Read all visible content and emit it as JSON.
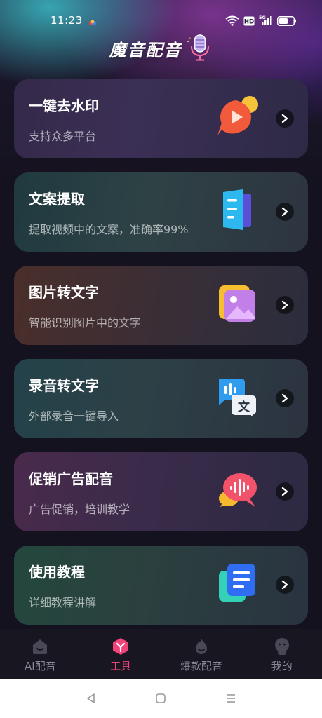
{
  "status_bar": {
    "time": "11:23",
    "hd_badge": "HD",
    "network": "5G",
    "icons": [
      "app-notification-icon",
      "wifi-icon",
      "hd-icon",
      "signal-5g-icon",
      "battery-icon"
    ]
  },
  "header": {
    "title": "魔音配音",
    "icon": "microphone-icon"
  },
  "cards": [
    {
      "title": "一键去水印",
      "subtitle": "支持众多平台",
      "icon": "play-bubble-icon"
    },
    {
      "title": "文案提取",
      "subtitle": "提取视频中的文案，准确率99%",
      "icon": "document-extract-icon"
    },
    {
      "title": "图片转文字",
      "subtitle": "智能识别图片中的文字",
      "icon": "image-icon"
    },
    {
      "title": "录音转文字",
      "subtitle": "外部录音一键导入",
      "icon": "audio-translate-icon"
    },
    {
      "title": "促销广告配音",
      "subtitle": "广告促销，培训教学",
      "icon": "voice-bubble-icon"
    },
    {
      "title": "使用教程",
      "subtitle": "详细教程讲解",
      "icon": "tutorial-doc-icon"
    }
  ],
  "tabbar": {
    "tabs": [
      {
        "label": "AI配音",
        "icon": "house-icon",
        "active": false
      },
      {
        "label": "工具",
        "icon": "tools-icon",
        "active": true
      },
      {
        "label": "爆款配音",
        "icon": "fire-icon",
        "active": false
      },
      {
        "label": "我的",
        "icon": "profile-icon",
        "active": false
      }
    ]
  },
  "navbar": {
    "buttons": [
      "back-icon",
      "home-icon",
      "menu-icon"
    ]
  },
  "colors": {
    "accent": "#f0437a",
    "tab_inactive": "#8a8795",
    "background": "#15121f"
  }
}
